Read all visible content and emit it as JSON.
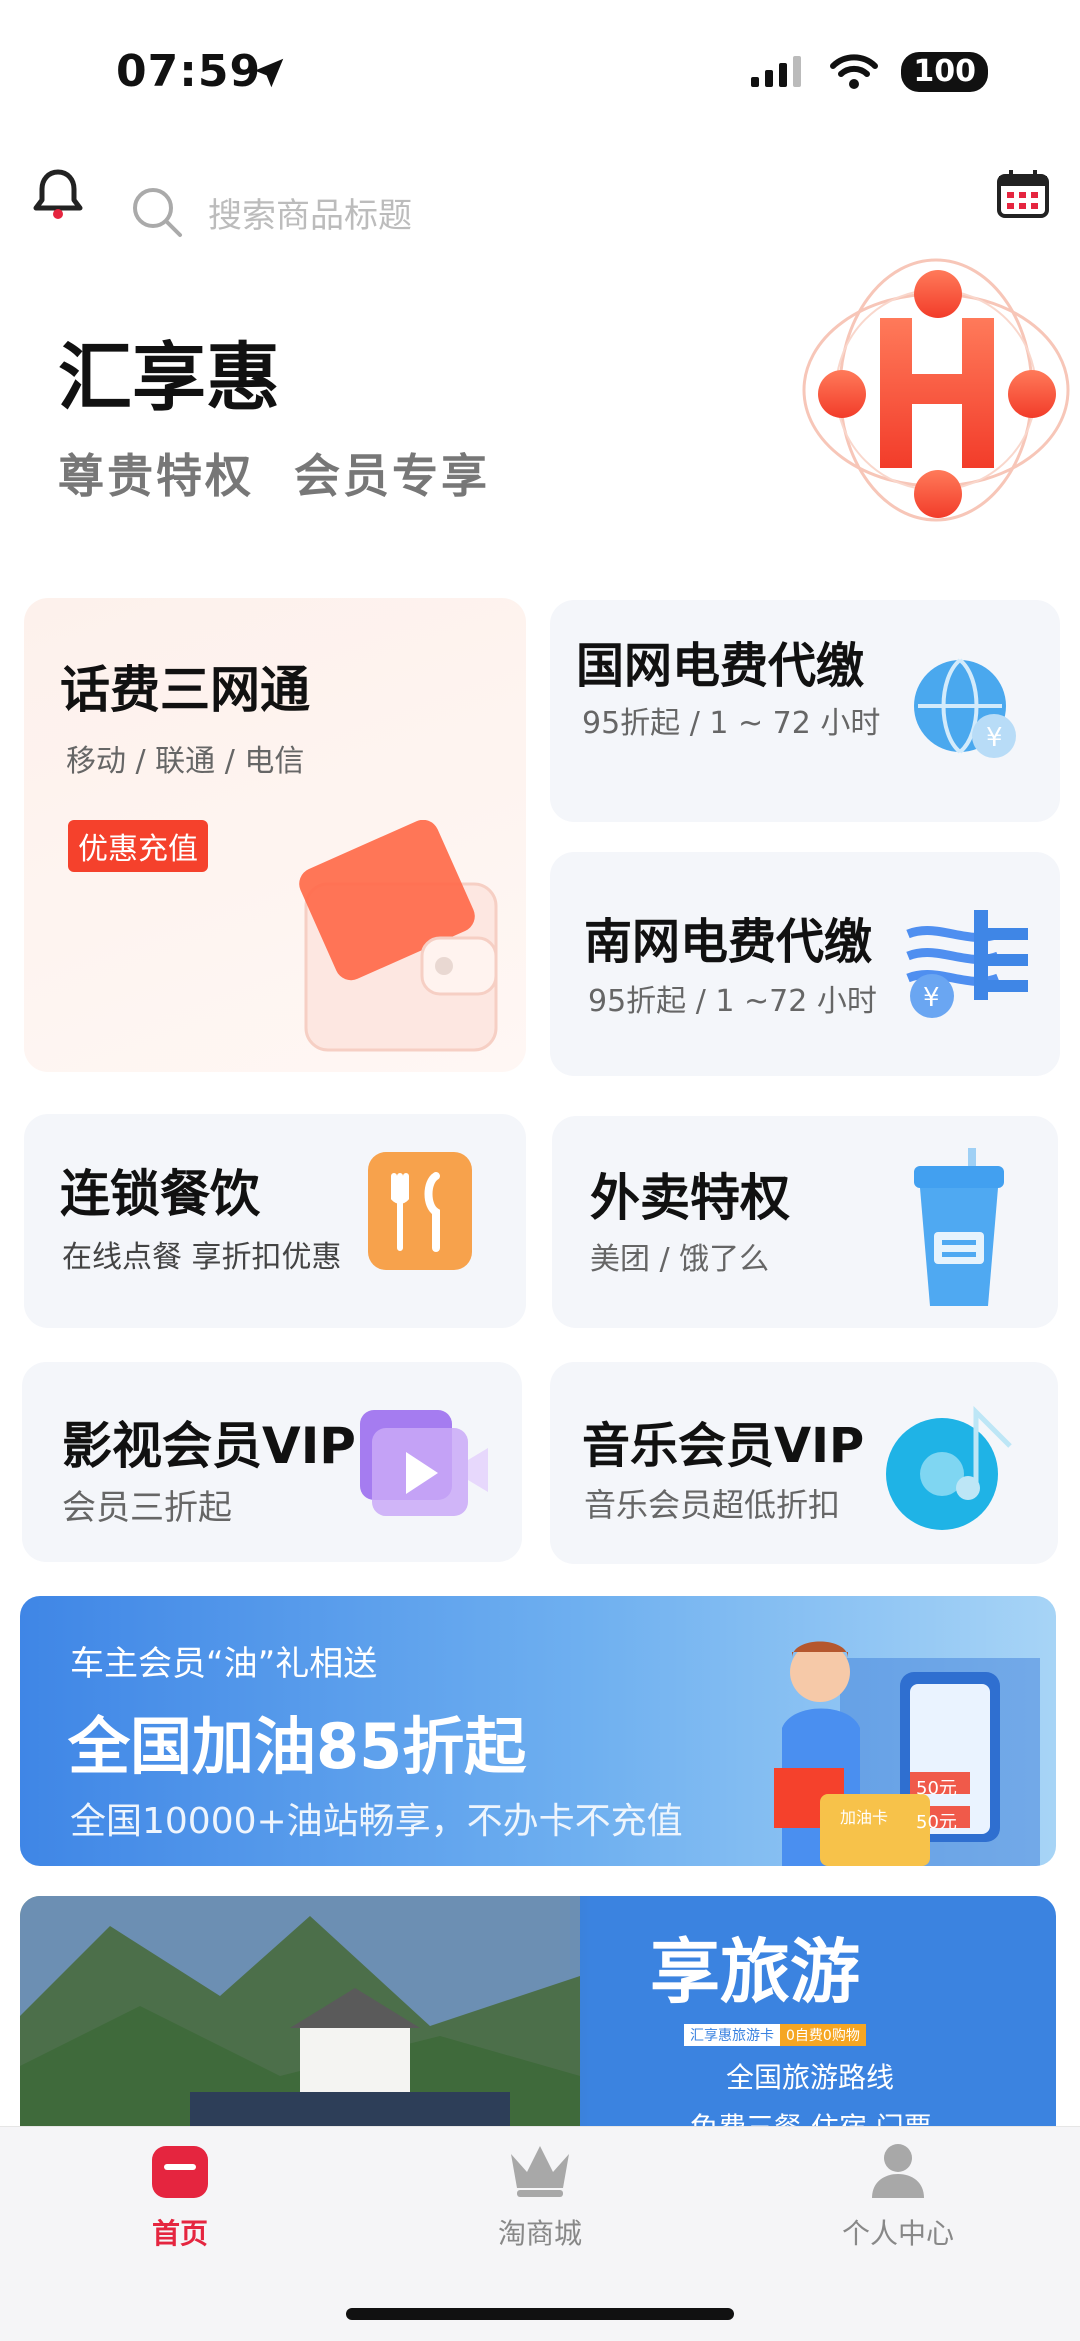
{
  "status_bar": {
    "time": "07:59",
    "battery": "100"
  },
  "header": {
    "search_placeholder": "搜索商品标题"
  },
  "hero": {
    "title": "汇享惠",
    "subtitle_left": "尊贵特权",
    "subtitle_right": "会员专享"
  },
  "cards": {
    "phone": {
      "title": "话费三网通",
      "sub": "移动 / 联通 / 电信",
      "badge": "优惠充值"
    },
    "state_grid": {
      "title": "国网电费代缴",
      "sub": "95折起 / 1 ~ 72 小时"
    },
    "south_grid": {
      "title": "南网电费代缴",
      "sub": "95折起 / 1 ~72 小时"
    },
    "chain_dining": {
      "title": "连锁餐饮",
      "sub": "在线点餐  享折扣优惠"
    },
    "takeout": {
      "title": "外卖特权",
      "sub": "美团 / 饿了么"
    },
    "video_vip": {
      "title": "影视会员VIP",
      "sub": "会员三折起"
    },
    "music_vip": {
      "title": "音乐会员VIP",
      "sub": "音乐会员超低折扣"
    }
  },
  "banner_fuel": {
    "kicker": "车主会员“油”礼相送",
    "headline": "全国加油85折起",
    "desc": "全国10000+油站畅享，不办卡不充值",
    "card_label": "加油卡",
    "ticket_1": "50元",
    "ticket_2": "50元"
  },
  "banner_travel": {
    "headline": "享旅游",
    "tag_left": "汇享惠旅游卡",
    "tag_right": "0自费0购物",
    "line1": "全国旅游路线",
    "line2": "免费三餐  住宿  门票"
  },
  "tabbar": {
    "home": "首页",
    "mall": "淘商城",
    "profile": "个人中心"
  },
  "colors": {
    "accent": "#e5253f",
    "blue": "#3b83e0",
    "orange": "#f5412c"
  }
}
